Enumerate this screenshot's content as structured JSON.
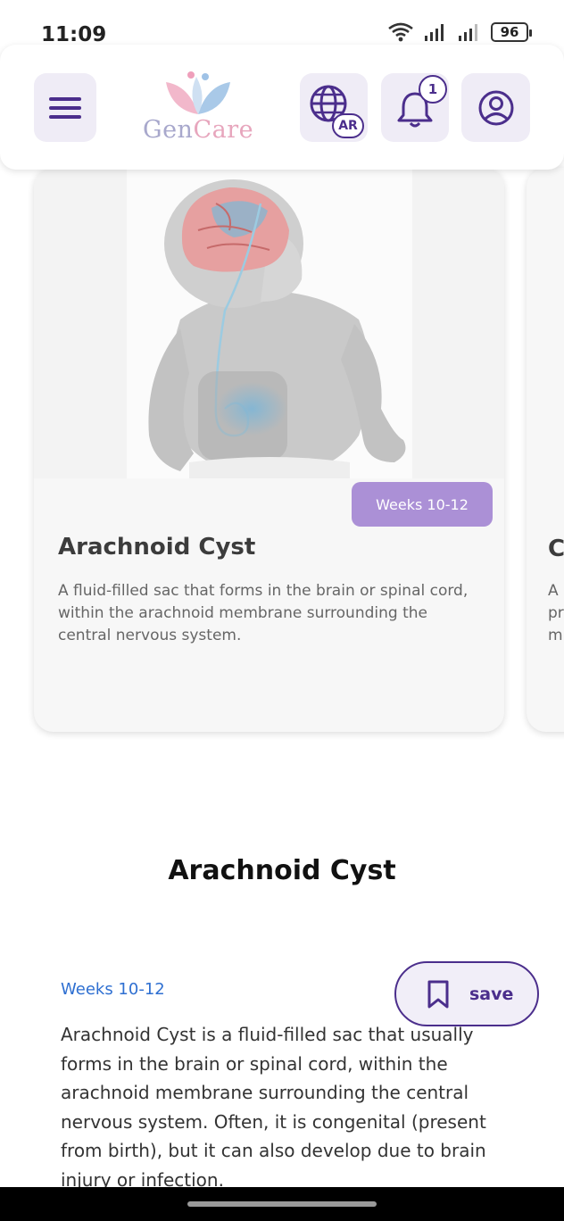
{
  "status_bar": {
    "time": "11:09",
    "battery": "96",
    "icons": [
      "wifi-icon",
      "signal-icon",
      "signal-icon",
      "battery-icon"
    ]
  },
  "header": {
    "menu_icon": "hamburger-menu-icon",
    "logo": {
      "part1": "Gen",
      "part2": "Care"
    },
    "language_badge": "AR",
    "notification_count": "1",
    "colors": {
      "accent": "#4b2e8c",
      "button_bg": "#efecf6",
      "badge": "#ab90d6"
    }
  },
  "carousel": {
    "cards": [
      {
        "week": "Weeks 10-12",
        "title": "Arachnoid Cyst",
        "description": "A fluid-filled sac that forms in the brain or spinal cord, within the arachnoid membrane surrounding the central nervous system."
      }
    ],
    "peek_card": {
      "title": "C",
      "description_lines": [
        "A",
        "pr",
        "m"
      ]
    }
  },
  "detail": {
    "title": "Arachnoid Cyst",
    "week": "Weeks 10-12",
    "save_label": "save",
    "body": "Arachnoid Cyst is a fluid-filled sac that usually forms in the brain or spinal cord, within the arachnoid membrane surrounding the central nervous system. Often, it is congenital (present from birth), but it can also develop due to brain injury or infection."
  }
}
